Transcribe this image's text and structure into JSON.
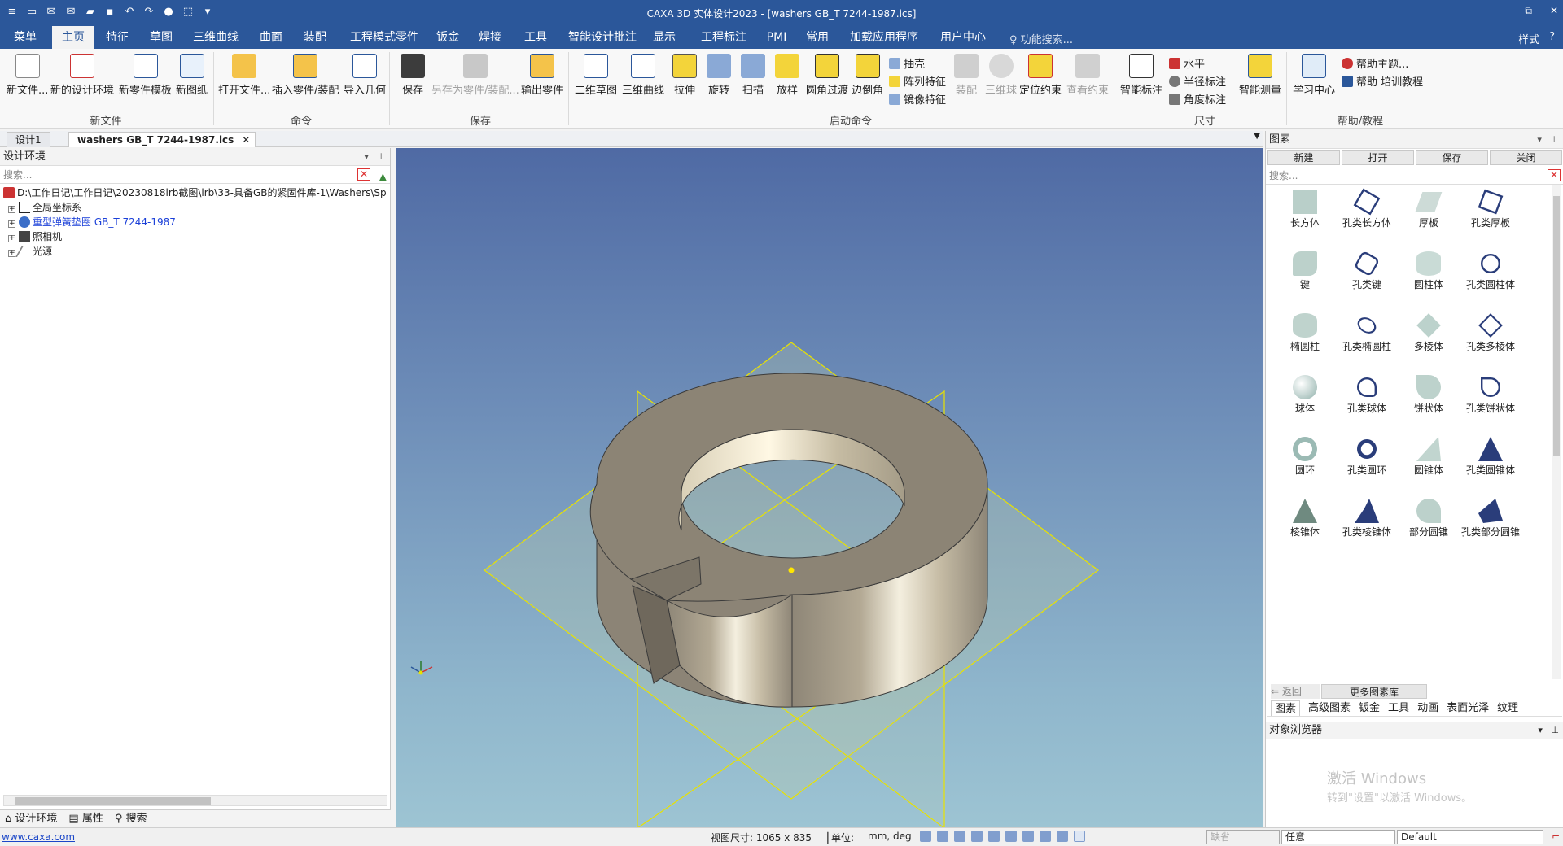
{
  "app": {
    "title": "CAXA 3D 实体设计2023 - [washers GB_T 7244-1987.ics]",
    "window_controls": [
      "–",
      "⧉",
      "✕"
    ]
  },
  "menubar": {
    "tabs": [
      "菜单",
      "主页",
      "特征",
      "草图",
      "三维曲线",
      "曲面",
      "装配",
      "工程模式零件",
      "钣金",
      "焊接",
      "工具",
      "智能设计批注",
      "显示",
      "工程标注",
      "PMI",
      "常用",
      "加载应用程序",
      "用户中心"
    ],
    "search_placeholder": "功能搜索...",
    "style_label": "样式",
    "help": "?"
  },
  "ribbon": {
    "new_file": {
      "new": "新文件...",
      "new_env": "新的设计环境",
      "new_part_tpl": "新零件模板",
      "new_drawing": "新图纸",
      "group": "新文件"
    },
    "command": {
      "open": "打开文件...",
      "insert": "插入零件/装配",
      "import": "导入几何",
      "group": "命令"
    },
    "save": {
      "save": "保存",
      "save_as": "另存为零件/装配...",
      "export": "输出零件",
      "group": "保存"
    },
    "launch": {
      "sketch2d": "二维草图",
      "curve3d": "三维曲线",
      "extrude": "拉伸",
      "revolve": "旋转",
      "sweep": "扫描",
      "loft": "放样",
      "fillet": "圆角过渡",
      "chamfer": "边倒角",
      "shell": "抽壳",
      "pattern": "阵列特征",
      "mirror": "镜像特征",
      "assembly": "装配",
      "ball3d": "三维球",
      "constraint": "定位约束",
      "view_constraint": "查看约束",
      "group": "启动命令"
    },
    "dimension": {
      "smart": "智能标注",
      "horizontal": "水平",
      "radius": "半径标注",
      "angle": "角度标注",
      "measure": "智能测量",
      "group": "尺寸"
    },
    "help": {
      "learn": "学习中心",
      "help_topics": "帮助主题...",
      "training": "帮助 培训教程",
      "group": "帮助/教程"
    }
  },
  "doc_tabs": [
    "设计1",
    "washers GB_T 7244-1987.ics"
  ],
  "left_panel": {
    "title": "设计环境",
    "search_placeholder": "搜索...",
    "path": "D:\\工作日记\\工作日记\\20230818lrb截图\\lrb\\33-具备GB的紧固件库-1\\Washers\\Sp",
    "tree": [
      "全局坐标系",
      "重型弹簧垫圈 GB_T 7244-1987",
      "照相机",
      "光源"
    ],
    "bottom_tabs": [
      "设计环境",
      "属性",
      "搜索"
    ]
  },
  "right_panel": {
    "title": "图素",
    "buttons": [
      "新建",
      "打开",
      "保存",
      "关闭"
    ],
    "search_placeholder": "搜索...",
    "items": [
      "长方体",
      "孔类长方体",
      "厚板",
      "孔类厚板",
      "键",
      "孔类键",
      "圆柱体",
      "孔类圆柱体",
      "椭圆柱",
      "孔类椭圆柱",
      "多棱体",
      "孔类多棱体",
      "球体",
      "孔类球体",
      "饼状体",
      "孔类饼状体",
      "圆环",
      "孔类圆环",
      "圆锥体",
      "孔类圆锥体",
      "棱锥体",
      "孔类棱锥体",
      "部分圆锥",
      "孔类部分圆锥"
    ],
    "back": "返回",
    "more": "更多图素库",
    "tabs": [
      "图素",
      "高级图素",
      "钣金",
      "工具",
      "动画",
      "表面光泽",
      "纹理"
    ],
    "object_browser": "对象浏览器"
  },
  "watermark": {
    "line1": "激活 Windows",
    "line2": "转到\"设置\"以激活 Windows。"
  },
  "status": {
    "link": "www.caxa.com",
    "view_size_label": "视图尺寸: 1065 x  835",
    "unit_label": "单位:",
    "unit_value": "mm, deg",
    "combo1": "缺省",
    "combo2": "任意",
    "combo3": "Default"
  },
  "colors": {
    "accent": "#2b579a",
    "viewport_top": "#4f6aa4",
    "viewport_bottom": "#9dc4d3",
    "washer": "#8d8678",
    "highlight": "#e8e200"
  }
}
